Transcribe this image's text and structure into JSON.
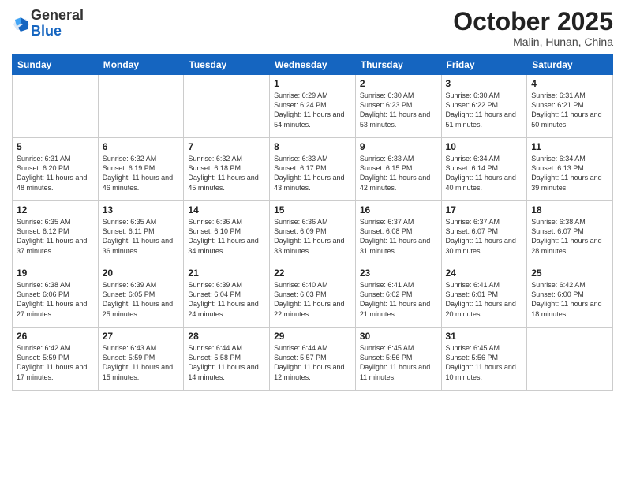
{
  "logo": {
    "general": "General",
    "blue": "Blue"
  },
  "title": "October 2025",
  "location": "Malin, Hunan, China",
  "headers": [
    "Sunday",
    "Monday",
    "Tuesday",
    "Wednesday",
    "Thursday",
    "Friday",
    "Saturday"
  ],
  "weeks": [
    [
      {
        "day": "",
        "sunrise": "",
        "sunset": "",
        "daylight": ""
      },
      {
        "day": "",
        "sunrise": "",
        "sunset": "",
        "daylight": ""
      },
      {
        "day": "",
        "sunrise": "",
        "sunset": "",
        "daylight": ""
      },
      {
        "day": "1",
        "sunrise": "Sunrise: 6:29 AM",
        "sunset": "Sunset: 6:24 PM",
        "daylight": "Daylight: 11 hours and 54 minutes."
      },
      {
        "day": "2",
        "sunrise": "Sunrise: 6:30 AM",
        "sunset": "Sunset: 6:23 PM",
        "daylight": "Daylight: 11 hours and 53 minutes."
      },
      {
        "day": "3",
        "sunrise": "Sunrise: 6:30 AM",
        "sunset": "Sunset: 6:22 PM",
        "daylight": "Daylight: 11 hours and 51 minutes."
      },
      {
        "day": "4",
        "sunrise": "Sunrise: 6:31 AM",
        "sunset": "Sunset: 6:21 PM",
        "daylight": "Daylight: 11 hours and 50 minutes."
      }
    ],
    [
      {
        "day": "5",
        "sunrise": "Sunrise: 6:31 AM",
        "sunset": "Sunset: 6:20 PM",
        "daylight": "Daylight: 11 hours and 48 minutes."
      },
      {
        "day": "6",
        "sunrise": "Sunrise: 6:32 AM",
        "sunset": "Sunset: 6:19 PM",
        "daylight": "Daylight: 11 hours and 46 minutes."
      },
      {
        "day": "7",
        "sunrise": "Sunrise: 6:32 AM",
        "sunset": "Sunset: 6:18 PM",
        "daylight": "Daylight: 11 hours and 45 minutes."
      },
      {
        "day": "8",
        "sunrise": "Sunrise: 6:33 AM",
        "sunset": "Sunset: 6:17 PM",
        "daylight": "Daylight: 11 hours and 43 minutes."
      },
      {
        "day": "9",
        "sunrise": "Sunrise: 6:33 AM",
        "sunset": "Sunset: 6:15 PM",
        "daylight": "Daylight: 11 hours and 42 minutes."
      },
      {
        "day": "10",
        "sunrise": "Sunrise: 6:34 AM",
        "sunset": "Sunset: 6:14 PM",
        "daylight": "Daylight: 11 hours and 40 minutes."
      },
      {
        "day": "11",
        "sunrise": "Sunrise: 6:34 AM",
        "sunset": "Sunset: 6:13 PM",
        "daylight": "Daylight: 11 hours and 39 minutes."
      }
    ],
    [
      {
        "day": "12",
        "sunrise": "Sunrise: 6:35 AM",
        "sunset": "Sunset: 6:12 PM",
        "daylight": "Daylight: 11 hours and 37 minutes."
      },
      {
        "day": "13",
        "sunrise": "Sunrise: 6:35 AM",
        "sunset": "Sunset: 6:11 PM",
        "daylight": "Daylight: 11 hours and 36 minutes."
      },
      {
        "day": "14",
        "sunrise": "Sunrise: 6:36 AM",
        "sunset": "Sunset: 6:10 PM",
        "daylight": "Daylight: 11 hours and 34 minutes."
      },
      {
        "day": "15",
        "sunrise": "Sunrise: 6:36 AM",
        "sunset": "Sunset: 6:09 PM",
        "daylight": "Daylight: 11 hours and 33 minutes."
      },
      {
        "day": "16",
        "sunrise": "Sunrise: 6:37 AM",
        "sunset": "Sunset: 6:08 PM",
        "daylight": "Daylight: 11 hours and 31 minutes."
      },
      {
        "day": "17",
        "sunrise": "Sunrise: 6:37 AM",
        "sunset": "Sunset: 6:07 PM",
        "daylight": "Daylight: 11 hours and 30 minutes."
      },
      {
        "day": "18",
        "sunrise": "Sunrise: 6:38 AM",
        "sunset": "Sunset: 6:07 PM",
        "daylight": "Daylight: 11 hours and 28 minutes."
      }
    ],
    [
      {
        "day": "19",
        "sunrise": "Sunrise: 6:38 AM",
        "sunset": "Sunset: 6:06 PM",
        "daylight": "Daylight: 11 hours and 27 minutes."
      },
      {
        "day": "20",
        "sunrise": "Sunrise: 6:39 AM",
        "sunset": "Sunset: 6:05 PM",
        "daylight": "Daylight: 11 hours and 25 minutes."
      },
      {
        "day": "21",
        "sunrise": "Sunrise: 6:39 AM",
        "sunset": "Sunset: 6:04 PM",
        "daylight": "Daylight: 11 hours and 24 minutes."
      },
      {
        "day": "22",
        "sunrise": "Sunrise: 6:40 AM",
        "sunset": "Sunset: 6:03 PM",
        "daylight": "Daylight: 11 hours and 22 minutes."
      },
      {
        "day": "23",
        "sunrise": "Sunrise: 6:41 AM",
        "sunset": "Sunset: 6:02 PM",
        "daylight": "Daylight: 11 hours and 21 minutes."
      },
      {
        "day": "24",
        "sunrise": "Sunrise: 6:41 AM",
        "sunset": "Sunset: 6:01 PM",
        "daylight": "Daylight: 11 hours and 20 minutes."
      },
      {
        "day": "25",
        "sunrise": "Sunrise: 6:42 AM",
        "sunset": "Sunset: 6:00 PM",
        "daylight": "Daylight: 11 hours and 18 minutes."
      }
    ],
    [
      {
        "day": "26",
        "sunrise": "Sunrise: 6:42 AM",
        "sunset": "Sunset: 5:59 PM",
        "daylight": "Daylight: 11 hours and 17 minutes."
      },
      {
        "day": "27",
        "sunrise": "Sunrise: 6:43 AM",
        "sunset": "Sunset: 5:59 PM",
        "daylight": "Daylight: 11 hours and 15 minutes."
      },
      {
        "day": "28",
        "sunrise": "Sunrise: 6:44 AM",
        "sunset": "Sunset: 5:58 PM",
        "daylight": "Daylight: 11 hours and 14 minutes."
      },
      {
        "day": "29",
        "sunrise": "Sunrise: 6:44 AM",
        "sunset": "Sunset: 5:57 PM",
        "daylight": "Daylight: 11 hours and 12 minutes."
      },
      {
        "day": "30",
        "sunrise": "Sunrise: 6:45 AM",
        "sunset": "Sunset: 5:56 PM",
        "daylight": "Daylight: 11 hours and 11 minutes."
      },
      {
        "day": "31",
        "sunrise": "Sunrise: 6:45 AM",
        "sunset": "Sunset: 5:56 PM",
        "daylight": "Daylight: 11 hours and 10 minutes."
      },
      {
        "day": "",
        "sunrise": "",
        "sunset": "",
        "daylight": ""
      }
    ]
  ]
}
